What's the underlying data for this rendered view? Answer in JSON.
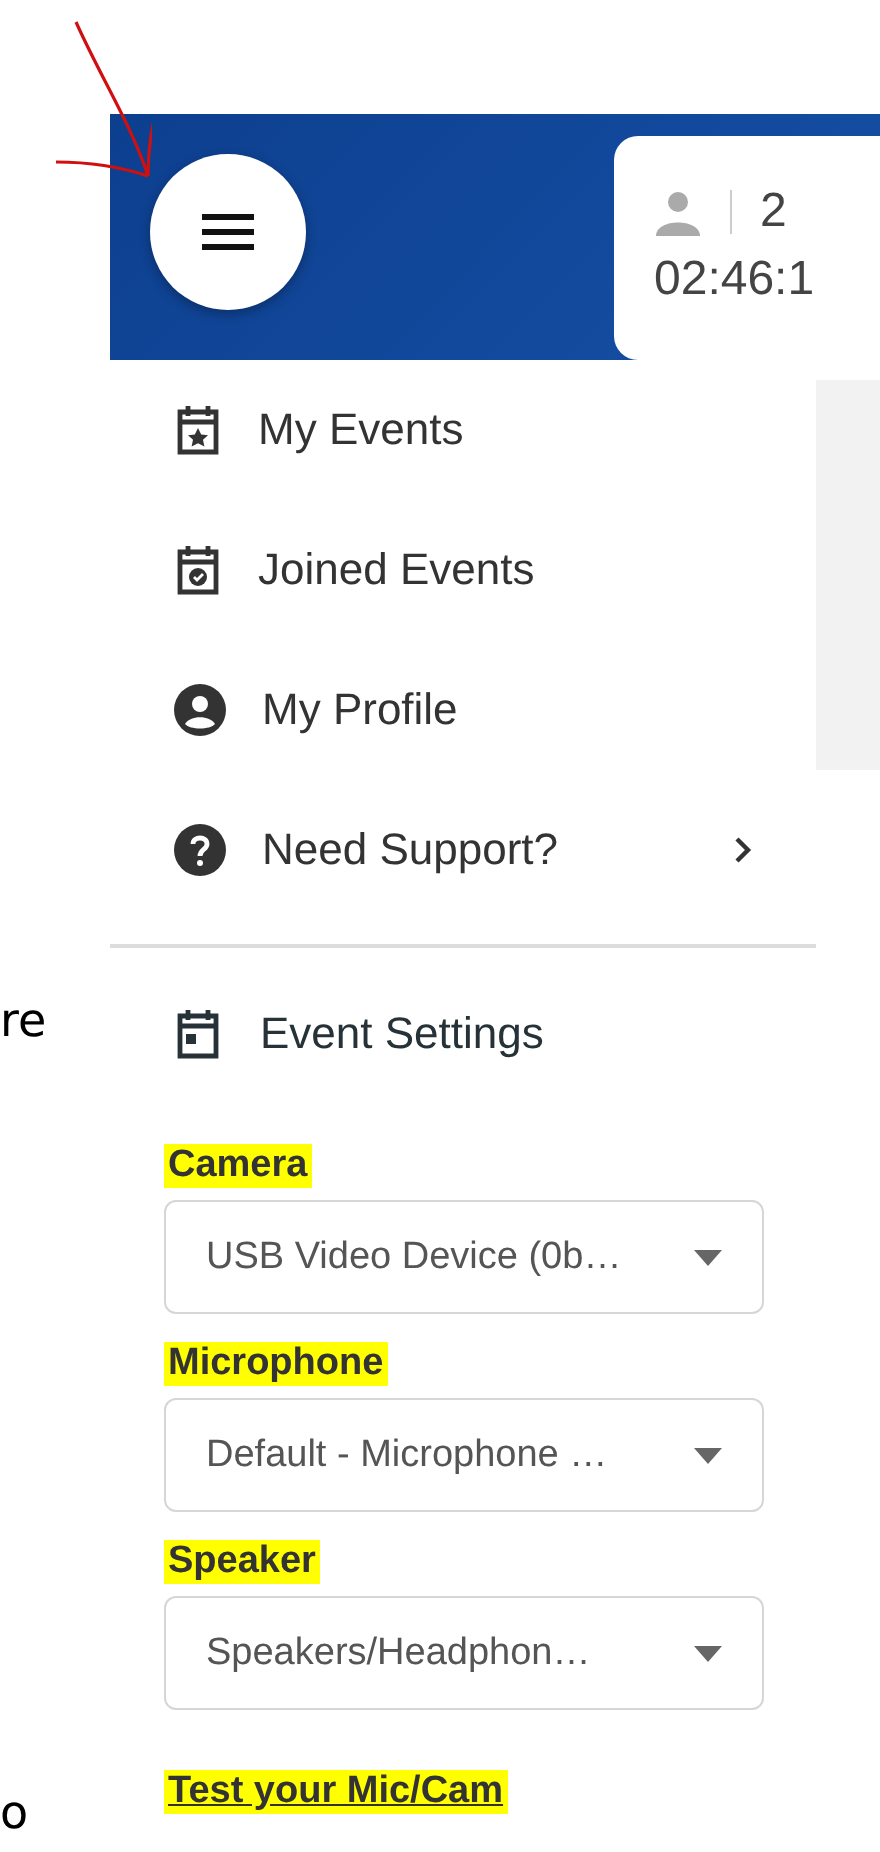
{
  "header": {
    "participants": "2",
    "timer": "02:46:1"
  },
  "menu": [
    {
      "label": "My Events",
      "has_submenu": false
    },
    {
      "label": "Joined Events",
      "has_submenu": false
    },
    {
      "label": "My Profile",
      "has_submenu": false
    },
    {
      "label": "Need Support?",
      "has_submenu": true
    }
  ],
  "settings": {
    "title": "Event Settings",
    "devices": [
      {
        "label": "Camera",
        "value": "USB Video Device (0b…",
        "highlighted": true
      },
      {
        "label": "Microphone",
        "value": "Default - Microphone …",
        "highlighted": true
      },
      {
        "label": "Speaker",
        "value": "Speakers/Headphon…",
        "highlighted": true
      }
    ],
    "test_link": {
      "label": "Test your Mic/Cam",
      "highlighted": true
    }
  },
  "background_text": [
    "re",
    "o"
  ]
}
